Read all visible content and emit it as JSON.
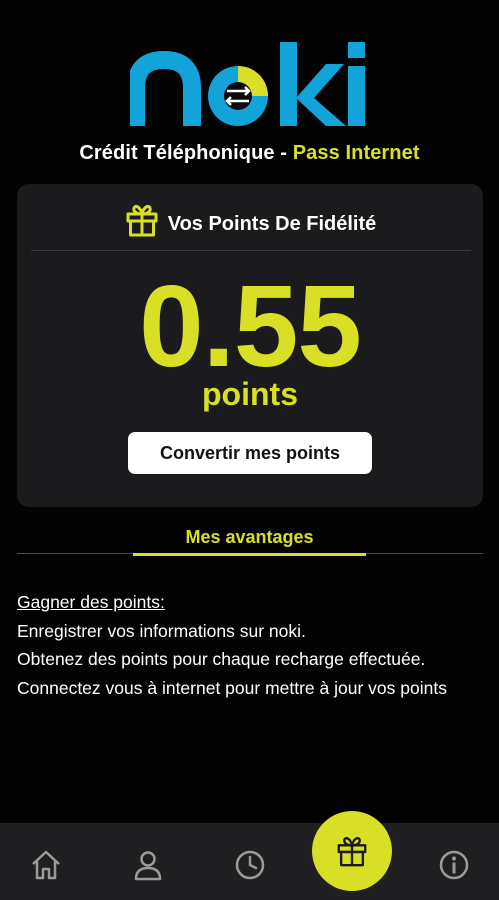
{
  "brand": {
    "logo_text": "noki",
    "accent_color": "#d7e025",
    "logo_color": "#12a3d8"
  },
  "header": {
    "subtitle_part1": "Crédit Téléphonique - ",
    "subtitle_part2": "Pass Internet"
  },
  "card": {
    "icon": "gift-icon",
    "title": "Vos Points De Fidélité",
    "points_value": "0.55",
    "points_unit": "points",
    "convert_button": "Convertir mes points"
  },
  "tabs": {
    "active_label": "Mes avantages"
  },
  "info": {
    "heading": "Gagner des points:",
    "lines": [
      "Enregistrer vos informations sur noki.",
      "Obtenez des points pour chaque recharge effectuée.",
      "Connectez vous à internet pour mettre à jour vos points"
    ]
  },
  "bottom_nav": {
    "items": [
      "home-icon",
      "user-icon",
      "clock-icon",
      "gift-icon",
      "info-icon"
    ],
    "active": "gift-icon"
  }
}
